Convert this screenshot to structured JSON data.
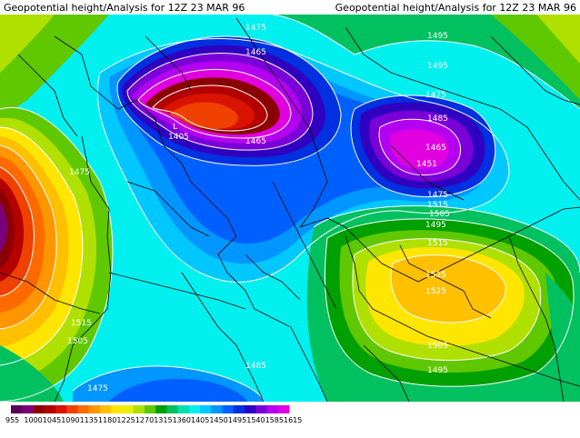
{
  "header": {
    "title_left": "Geopotential height/Analysis for 12Z 23 MAR 96",
    "title_right": "Geopotential height/Analysis for 12Z 23 MAR 96"
  },
  "centers": [
    {
      "label": "L",
      "value": "1405"
    },
    {
      "value": "1451"
    }
  ],
  "contour_labels": [
    "1475",
    "1495",
    "1465",
    "1495",
    "1475",
    "1465",
    "1475",
    "1515",
    "1505",
    "1495",
    "1485",
    "1465",
    "1475",
    "1525",
    "1525",
    "1515",
    "1505",
    "1495",
    "1515",
    "1505",
    "1485",
    "1475"
  ],
  "color_scale": {
    "colors": [
      "#5a005a",
      "#7a007a",
      "#8b0000",
      "#b30000",
      "#d81400",
      "#f04000",
      "#ff6a00",
      "#ff9600",
      "#ffc000",
      "#ffe600",
      "#e8f000",
      "#b0e000",
      "#60c800",
      "#00a000",
      "#00c060",
      "#00e0b0",
      "#00f0f0",
      "#00c8ff",
      "#0096ff",
      "#0060ff",
      "#0030e0",
      "#3000c0",
      "#7a00d8",
      "#b400f0",
      "#e000e0"
    ],
    "labels": [
      "955",
      "1000",
      "1045",
      "1090",
      "1135",
      "1180",
      "1225",
      "1270",
      "1315",
      "1360",
      "1405",
      "1450",
      "1495",
      "1540",
      "1585",
      "1615"
    ]
  }
}
